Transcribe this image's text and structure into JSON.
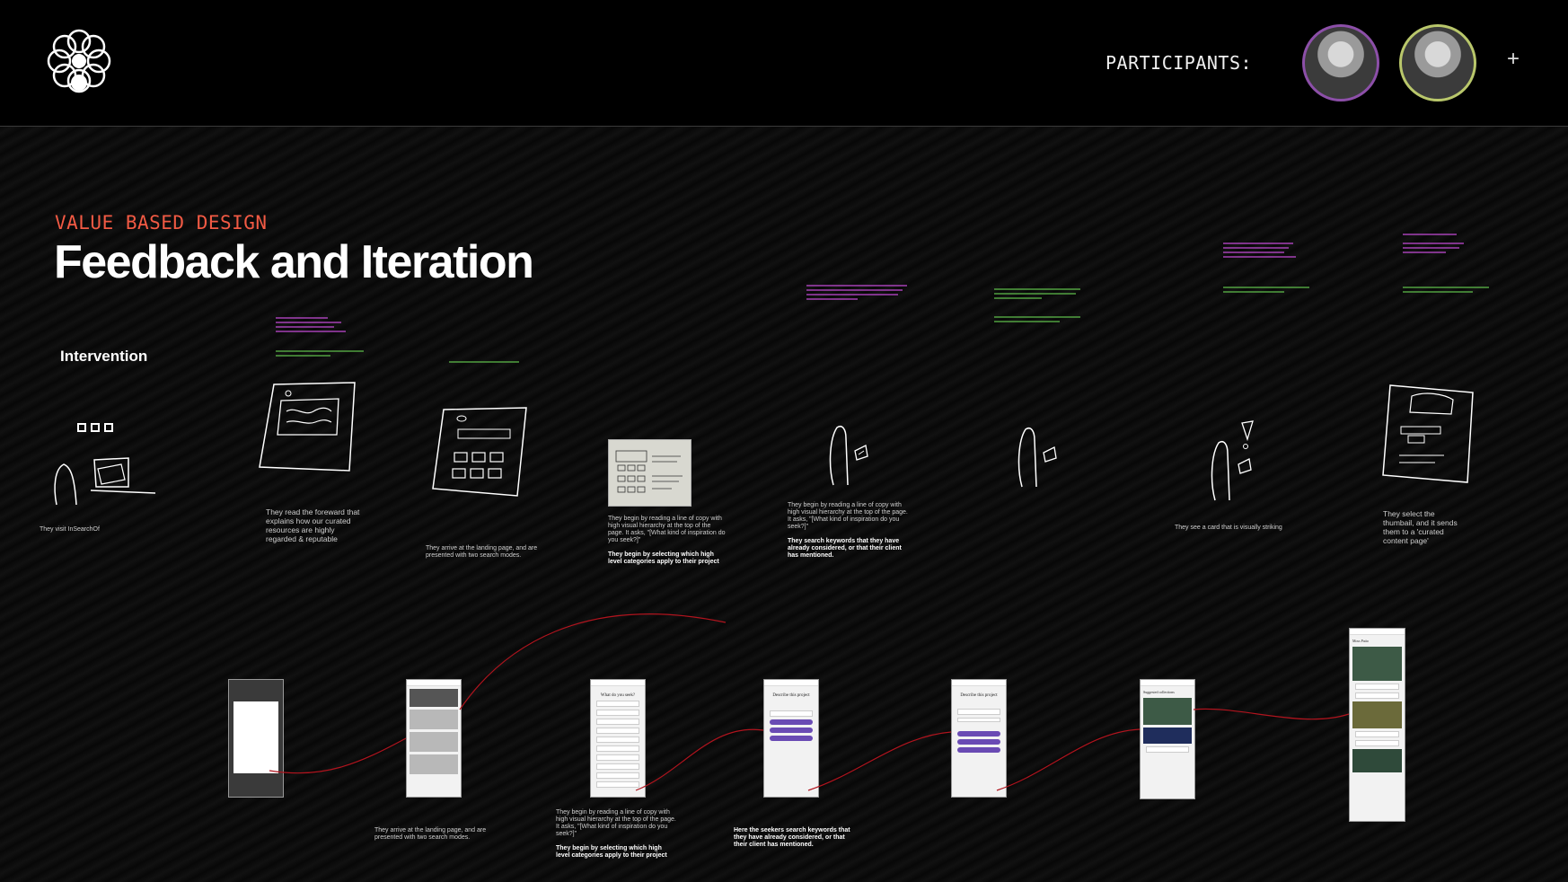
{
  "header": {
    "participants_label": "PARTICIPANTS:",
    "add_label": "+"
  },
  "board": {
    "eyebrow": "VALUE BASED DESIGN",
    "title": "Feedback and Iteration",
    "section": "Intervention"
  },
  "sketch_captions": {
    "s1": "They visit InSearchOf",
    "s2": "They read the foreward that explains how our curated resources are highly regarded & reputable",
    "s3": "They arrive at the landing page, and are presented with two search modes.",
    "s4_text": "They begin by reading a line of copy with high visual hierarchy at the top of the page. It asks, \"[What kind of inspiration do you seek?]\"",
    "s4_bold": "They begin by selecting which high level categories apply to their project",
    "s5_text": "They begin by reading a line of copy with high visual hierarchy at the top of the page. It asks, \"[What kind of inspiration do you seek?]\"",
    "s5_bold": "They search keywords that they have already considered, or that their client has mentioned.",
    "s7": "They see a card that is visually striking",
    "s8": "They select the thumbail, and it sends them to a 'curated content page'"
  },
  "screen_captions": {
    "c2": "They arrive at the landing page, and are presented with two search modes.",
    "c3_text": "They begin by reading a line of copy with high visual hierarchy at the top of the page. It asks, \"[What kind of inspiration do you seek?]\"",
    "c3_bold": "They begin by selecting which high level categories apply to their project",
    "c4_bold": "Here the seekers search keywords that they have already considered, or that their client has mentioned."
  },
  "screens": {
    "s3_title": "What do you seek?",
    "s4_title": "Describe this project",
    "s5_title": "Describe this project",
    "s6_title": "Suggested collections",
    "s7_title": "Moss Patio"
  },
  "colors": {
    "accent": "#f25a44",
    "note_pink": "#c44bd6",
    "note_green": "#5fbe4b",
    "flow_line": "#b0141e",
    "pill": "#6a4bb4"
  }
}
